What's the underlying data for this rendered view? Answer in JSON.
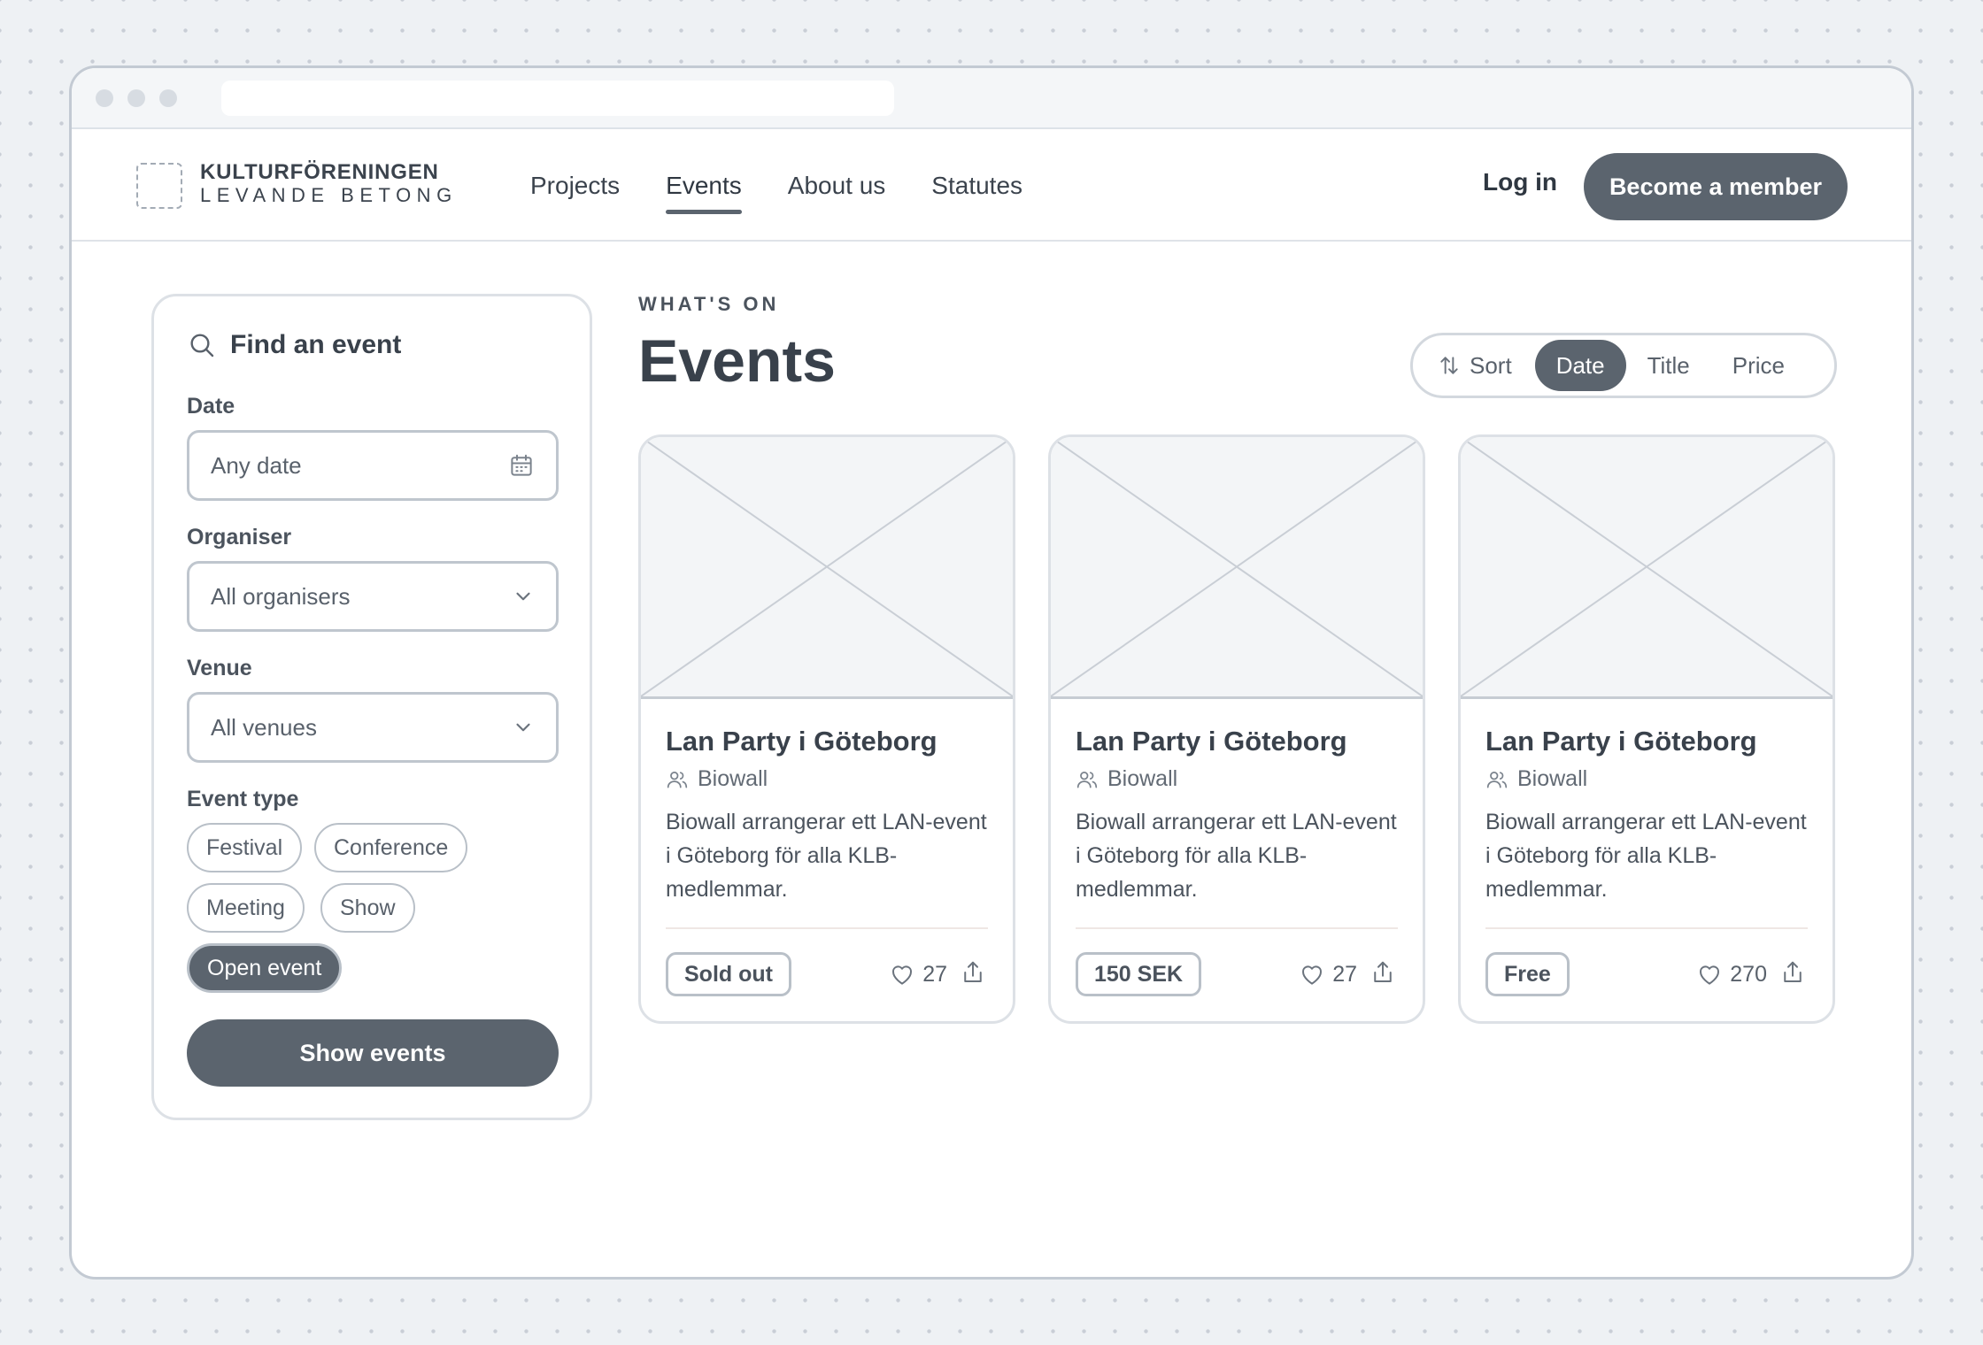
{
  "brand": {
    "line1": "KULTURFÖRENINGEN",
    "line2": "LEVANDE BETONG"
  },
  "nav": [
    {
      "label": "Projects",
      "active": false
    },
    {
      "label": "Events",
      "active": true
    },
    {
      "label": "About us",
      "active": false
    },
    {
      "label": "Statutes",
      "active": false
    }
  ],
  "header": {
    "login_label": "Log in",
    "member_label": "Become a member"
  },
  "filters": {
    "title": "Find an event",
    "date_label": "Date",
    "date_value": "Any date",
    "organiser_label": "Organiser",
    "organiser_value": "All organisers",
    "venue_label": "Venue",
    "venue_value": "All venues",
    "event_type_label": "Event type",
    "event_types": [
      {
        "label": "Festival",
        "selected": false
      },
      {
        "label": "Conference",
        "selected": false
      },
      {
        "label": "Meeting",
        "selected": false
      },
      {
        "label": "Show",
        "selected": false
      },
      {
        "label": "Open event",
        "selected": true
      }
    ],
    "submit_label": "Show events"
  },
  "main": {
    "eyebrow": "WHAT'S ON",
    "title": "Events",
    "sort": {
      "label": "Sort",
      "options": [
        {
          "label": "Date",
          "active": true
        },
        {
          "label": "Title",
          "active": false
        },
        {
          "label": "Price",
          "active": false
        }
      ]
    },
    "events": [
      {
        "title": "Lan Party i Göteborg",
        "organiser": "Biowall",
        "description": "Biowall arrangerar ett LAN-event i Göteborg för alla KLB-medlemmar.",
        "badge": "Sold out",
        "likes": "27"
      },
      {
        "title": "Lan Party i Göteborg",
        "organiser": "Biowall",
        "description": "Biowall arrangerar ett LAN-event i Göteborg för alla KLB-medlemmar.",
        "badge": "150 SEK",
        "likes": "27"
      },
      {
        "title": "Lan Party i Göteborg",
        "organiser": "Biowall",
        "description": "Biowall arrangerar ett LAN-event i Göteborg för alla KLB-medlemmar.",
        "badge": "Free",
        "likes": "270"
      }
    ]
  },
  "colors": {
    "accent": "#5b646e",
    "border": "#c3cad3",
    "text": "#3e4650"
  }
}
